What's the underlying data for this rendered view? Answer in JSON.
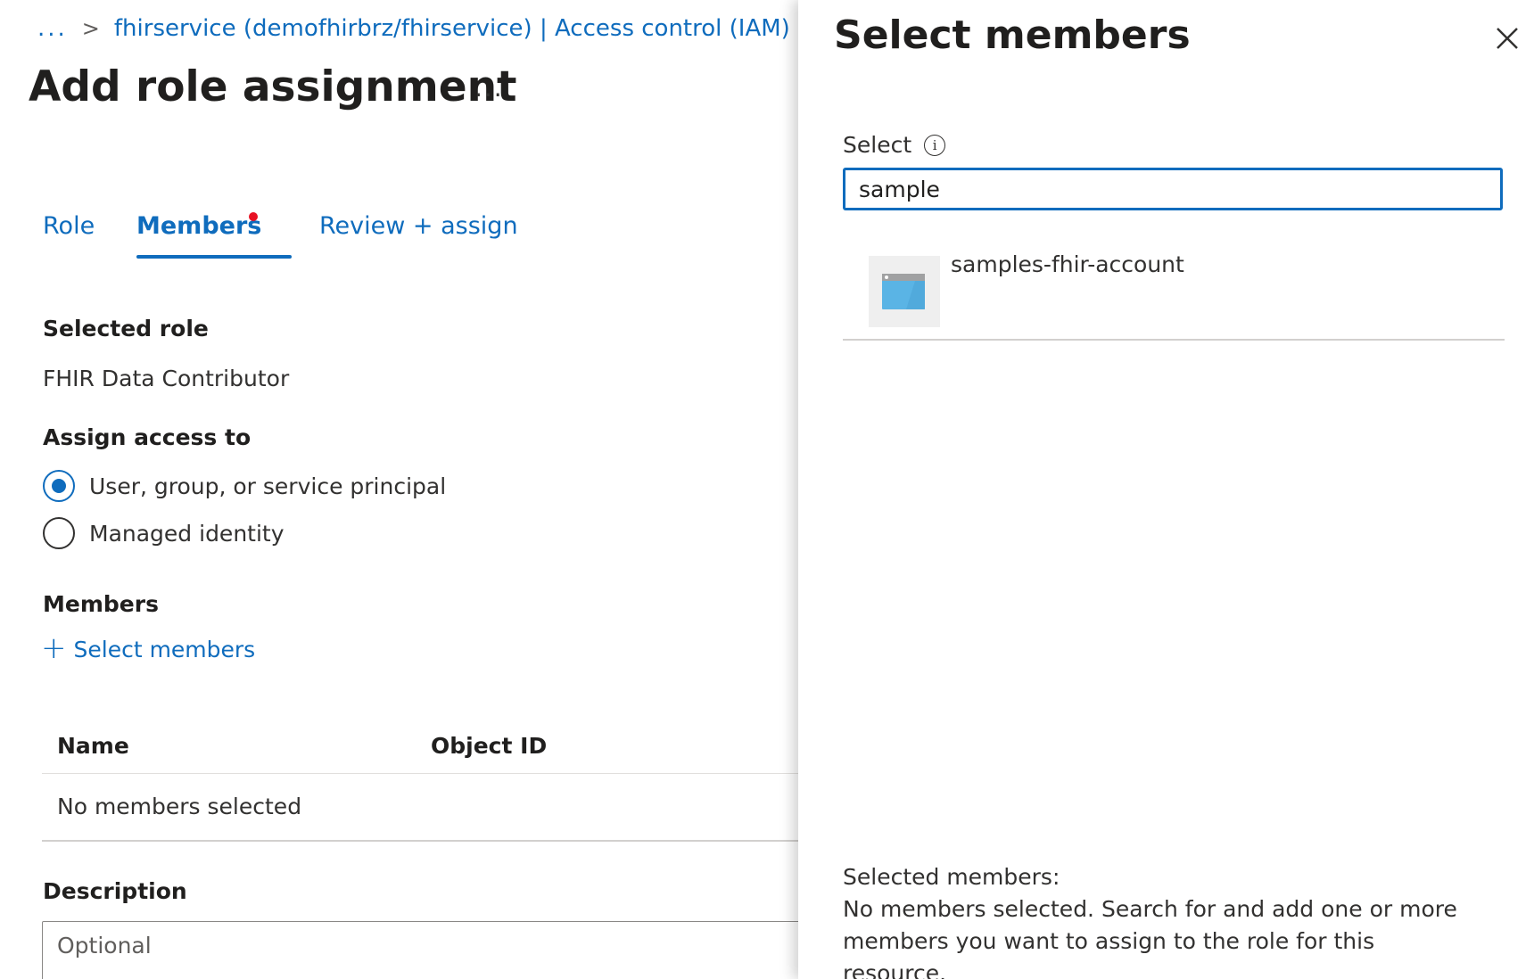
{
  "breadcrumb": {
    "ellipsis": "...",
    "separator": ">",
    "link": "fhirservice (demofhirbrz/fhirservice) | Access control (IAM)",
    "trailing_separator": ">"
  },
  "page": {
    "title": "Add role assignment",
    "more": "..."
  },
  "tabs": [
    {
      "label": "Role"
    },
    {
      "label": "Members",
      "active": true
    },
    {
      "label": "Review + assign"
    }
  ],
  "selected_role": {
    "heading": "Selected role",
    "value": "FHIR Data Contributor"
  },
  "assign_access": {
    "heading": "Assign access to",
    "options": [
      {
        "label": "User, group, or service principal",
        "checked": true
      },
      {
        "label": "Managed identity",
        "checked": false
      }
    ]
  },
  "members": {
    "heading": "Members",
    "add_label": "Select members",
    "add_icon": "+",
    "table": {
      "columns": [
        "Name",
        "Object ID"
      ],
      "empty_text": "No members selected"
    }
  },
  "description": {
    "heading": "Description",
    "placeholder": "Optional"
  },
  "flyout": {
    "title": "Select members",
    "select_label": "Select",
    "info_icon": "i",
    "search_value": "sample",
    "results": [
      {
        "name": "samples-fhir-account",
        "icon": "app-registration-icon"
      }
    ],
    "selected_heading": "Selected members:",
    "selected_message": "No members selected. Search for and add one or more members you want to assign to the role for this resource."
  },
  "colors": {
    "accent": "#0f6cbd",
    "notification_dot": "#e81123"
  }
}
